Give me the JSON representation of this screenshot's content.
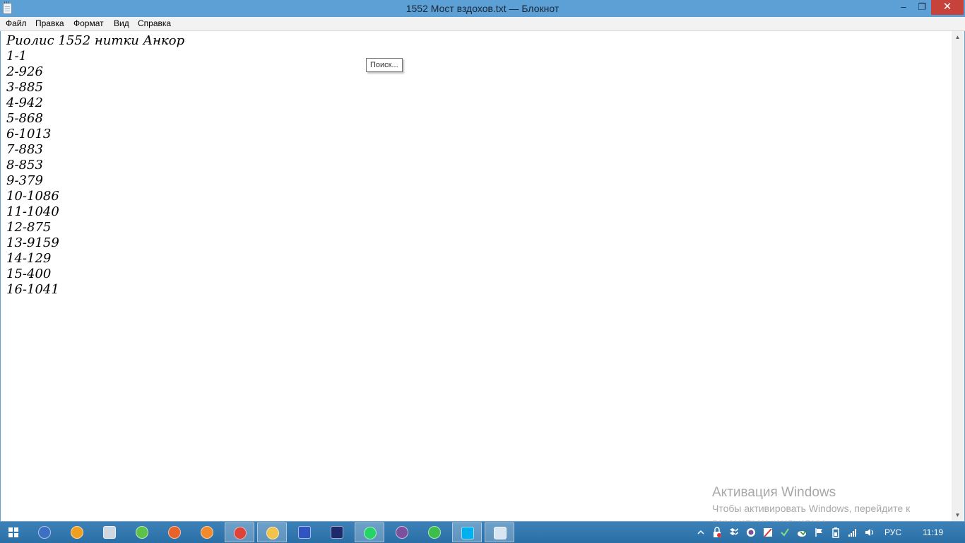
{
  "window": {
    "title": "1552 Мост вздохов.txt — Блокнот",
    "minimize_glyph": "–",
    "maximize_glyph": "❐",
    "close_glyph": "✕"
  },
  "menu": {
    "items": [
      "Файл",
      "Правка",
      "Формат",
      "Вид",
      "Справка"
    ]
  },
  "editor": {
    "lines": [
      "Риолис 1552 нитки Анкор",
      "1-1",
      "2-926",
      "3-885",
      "4-942",
      "5-868",
      "6-1013",
      "7-883",
      "8-853",
      "9-379",
      "10-1086",
      "11-1040",
      "12-875",
      "13-9159",
      "14-129",
      "15-400",
      "16-1041"
    ],
    "tooltip": "Поиск..."
  },
  "watermark": {
    "title": "Активация Windows",
    "line1": "Чтобы активировать Windows, перейдите к",
    "line2": "параметрам компьютера."
  },
  "taskbar": {
    "apps": [
      {
        "icon": "network-drive-icon",
        "color": "#3d6fc4",
        "active": false
      },
      {
        "icon": "aimp-icon",
        "color": "#f0a020",
        "active": false
      },
      {
        "icon": "calculator-icon",
        "color": "#cfd8e2",
        "active": false
      },
      {
        "icon": "globe-icon",
        "color": "#5cc24a",
        "active": false
      },
      {
        "icon": "firefox-icon",
        "color": "#e8632a",
        "active": false
      },
      {
        "icon": "paint-icon",
        "color": "#f08a2a",
        "active": false
      },
      {
        "icon": "chrome-icon",
        "color": "#db4437",
        "active": true
      },
      {
        "icon": "file-explorer-icon",
        "color": "#f2c34a",
        "active": true
      },
      {
        "icon": "floppy-save-icon",
        "color": "#2f56c0",
        "active": false
      },
      {
        "icon": "fm-app-icon",
        "color": "#1d2a6e",
        "active": false
      },
      {
        "icon": "whatsapp-icon",
        "color": "#25d366",
        "active": true
      },
      {
        "icon": "viber-icon",
        "color": "#7b519d",
        "active": false
      },
      {
        "icon": "mail-agent-icon",
        "color": "#3cbf4a",
        "active": false
      },
      {
        "icon": "skype-icon",
        "color": "#00aff0",
        "active": true
      },
      {
        "icon": "notepad-icon",
        "color": "#d8e6f2",
        "active": true
      }
    ],
    "tray_icons": [
      "chevron-up-icon",
      "lock-icon",
      "dropbox-icon",
      "viber-tray-icon",
      "antivirus-icon",
      "checkmark-icon",
      "network-cloud-icon",
      "flag-icon",
      "battery-icon",
      "signal-icon",
      "speaker-icon"
    ],
    "language": "РУС",
    "clock": "11:19"
  }
}
